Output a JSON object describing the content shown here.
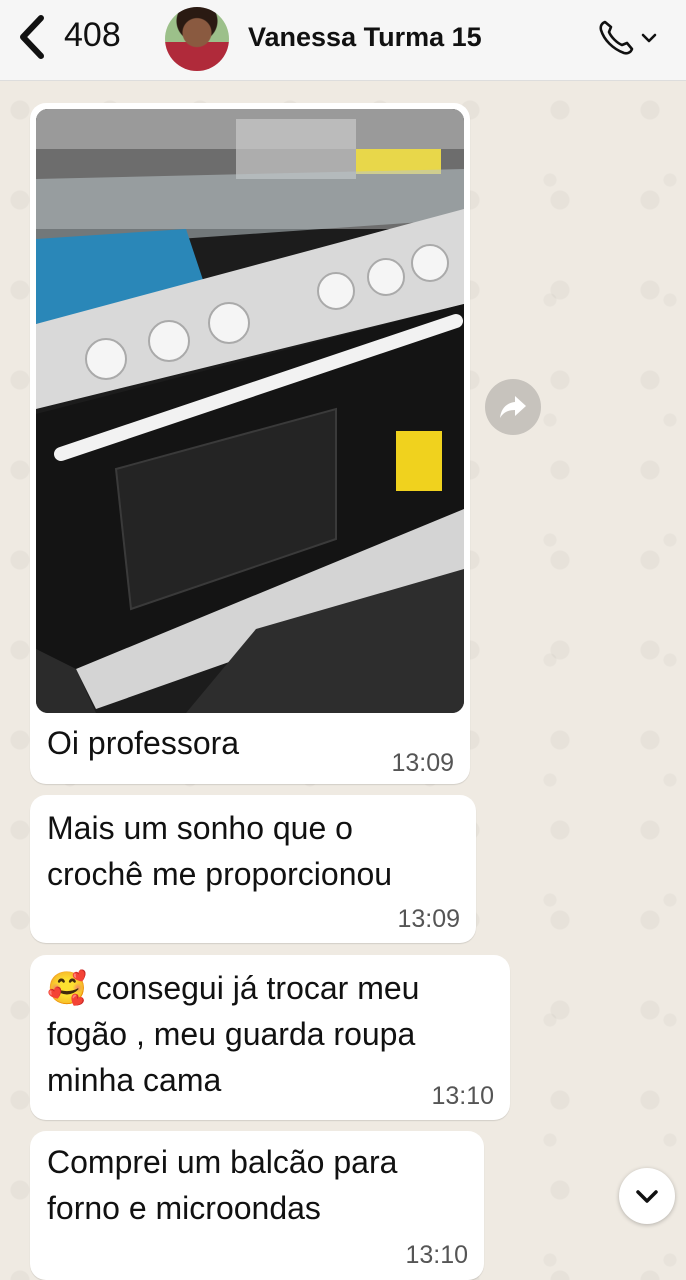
{
  "header": {
    "back_count": "408",
    "contact_name": "Vanessa Turma 15"
  },
  "messages": [
    {
      "type": "image",
      "caption": "Oi professora",
      "time": "13:09"
    },
    {
      "type": "text",
      "text": "Mais um sonho que o\ncrochê me proporcionou",
      "time": "13:09"
    },
    {
      "type": "text",
      "emoji": "🥰",
      "text": "consegui já trocar meu\nfogão , meu guarda roupa\nminha cama",
      "time": "13:10"
    },
    {
      "type": "text",
      "text": "Comprei um balcão para\nforno e microondas",
      "time": "13:10"
    }
  ],
  "colors": {
    "wallpaper": "#efeae2",
    "bubble": "#ffffff",
    "header": "#f6f6f6"
  },
  "icons": [
    "chevron-left-icon",
    "phone-icon",
    "chevron-down-icon",
    "forward-icon"
  ]
}
